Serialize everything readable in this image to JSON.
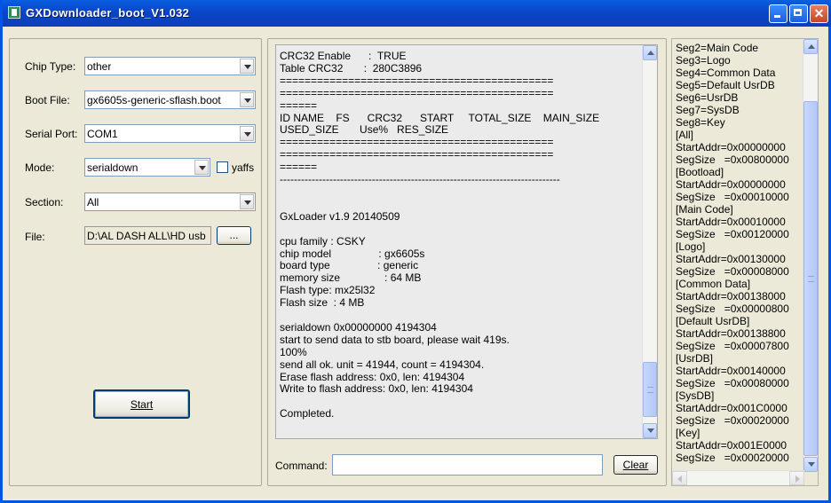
{
  "window": {
    "title": "GXDownloader_boot_V1.032"
  },
  "left": {
    "chip_type": {
      "label": "Chip Type:",
      "value": "other"
    },
    "boot_file": {
      "label": "Boot File:",
      "value": "gx6605s-generic-sflash.boot"
    },
    "serial_port": {
      "label": "Serial Port:",
      "value": "COM1"
    },
    "mode": {
      "label": "Mode:",
      "value": "serialdown"
    },
    "yaffs": {
      "label": "yaffs",
      "checked": false
    },
    "section": {
      "label": "Section:",
      "value": "All"
    },
    "file": {
      "label": "File:",
      "value": "D:\\AL DASH  ALL\\HD usb",
      "browse_label": "..."
    },
    "start_label": "Start"
  },
  "console": {
    "text": "CRC32 Enable      :  TRUE\nTable CRC32       :  280C3896\n============================================\n============================================\n======\nID NAME    FS      CRC32      START     TOTAL_SIZE    MAIN_SIZE\nUSED_SIZE       Use%   RES_SIZE\n============================================\n============================================\n======\n-------------------------------------------------------------------------------\n\n\nGxLoader v1.9 20140509\n\ncpu family : CSKY\nchip model                : gx6605s\nboard type                : generic\nmemory size               : 64 MB\nFlash type: mx25l32\nFlash size  : 4 MB\n\nserialdown 0x00000000 4194304\nstart to send data to stb board, please wait 419s.\n100%\nsend all ok. unit = 41944, count = 4194304.\nErase flash address: 0x0, len: 4194304\nWrite to flash address: 0x0, len: 4194304\n\nCompleted.",
    "scroll_position": 0.98
  },
  "command": {
    "label": "Command:",
    "value": "",
    "clear_label": "Clear"
  },
  "segments": {
    "text": "Seg2=Main Code\nSeg3=Logo\nSeg4=Common Data\nSeg5=Default UsrDB\nSeg6=UsrDB\nSeg7=SysDB\nSeg8=Key\n[All]\nStartAddr=0x00000000\nSegSize   =0x00800000\n[Bootload]\nStartAddr=0x00000000\nSegSize   =0x00010000\n[Main Code]\nStartAddr=0x00010000\nSegSize   =0x00120000\n[Logo]\nStartAddr=0x00130000\nSegSize   =0x00008000\n[Common Data]\nStartAddr=0x00138000\nSegSize   =0x00000800\n[Default UsrDB]\nStartAddr=0x00138800\nSegSize   =0x00007800\n[UsrDB]\nStartAddr=0x00140000\nSegSize   =0x00080000\n[SysDB]\nStartAddr=0x001C0000\nSegSize   =0x00020000\n[Key]\nStartAddr=0x001E0000\nSegSize   =0x00020000",
    "scroll_position": 0.98
  }
}
